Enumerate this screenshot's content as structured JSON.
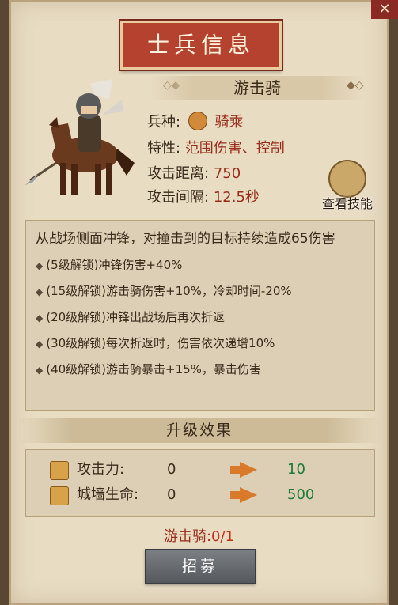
{
  "title": "士兵信息",
  "unit": {
    "name": "游击骑",
    "type_label": "兵种:",
    "type_value": "骑乘",
    "trait_label": "特性:",
    "trait_value": "范围伤害、控制",
    "range_label": "攻击距离:",
    "range_value": "750",
    "interval_label": "攻击间隔:",
    "interval_value": "12.5秒"
  },
  "skill_button_label": "查看技能",
  "description": {
    "main": "从战场侧面冲锋，对撞击到的目标持续造成65伤害",
    "items": [
      "(5级解锁)冲锋伤害+40%",
      "(15级解锁)游击骑伤害+10%，冷却时间-20%",
      "(20级解锁)冲锋出战场后再次折返",
      "(30级解锁)每次折返时，伤害依次递增10%",
      "(40级解锁)游击骑暴击+15%，暴击伤害"
    ]
  },
  "upgrade": {
    "section_title": "升级效果",
    "stats": [
      {
        "label": "攻击力:",
        "from": "0",
        "to": "10",
        "icon": "sword-icon"
      },
      {
        "label": "城墙生命:",
        "from": "0",
        "to": "500",
        "icon": "wall-icon"
      }
    ]
  },
  "recruit": {
    "unit_label": "游击骑:",
    "count": "0/1",
    "button_label": "招募"
  },
  "colors": {
    "title_plate": "#b4422f",
    "value_red": "#9a2b1a",
    "stat_green": "#1e7a3a",
    "arrow_orange": "#d97a2a",
    "panel_bg": "#e8dcc3"
  }
}
